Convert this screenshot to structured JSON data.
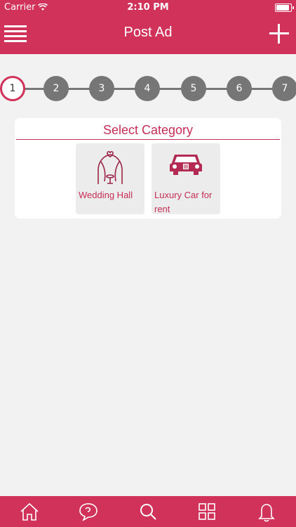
{
  "status_bar": {
    "carrier": "Carrier",
    "time": "2:10 PM",
    "battery_level": 0.9
  },
  "header": {
    "title": "Post Ad",
    "menu_icon": "menu-icon",
    "add_icon": "plus-icon"
  },
  "stepper": {
    "current": "1",
    "steps": [
      "1",
      "2",
      "3",
      "4",
      "5",
      "6",
      "7"
    ]
  },
  "category_card": {
    "title": "Select Category",
    "categories": [
      {
        "label": "Wedding Hall",
        "icon": "wedding-arch-icon"
      },
      {
        "label": "Luxury Car for rent",
        "icon": "car-icon"
      }
    ]
  },
  "tab_bar": {
    "tabs": [
      {
        "icon": "home-icon"
      },
      {
        "icon": "chat-icon"
      },
      {
        "icon": "search-icon"
      },
      {
        "icon": "grid-icon"
      },
      {
        "icon": "bell-icon"
      }
    ]
  },
  "colors": {
    "primary": "#d0325a",
    "accent_text": "#c62e56",
    "step_inactive": "#767676",
    "background": "#f2f2f2"
  }
}
